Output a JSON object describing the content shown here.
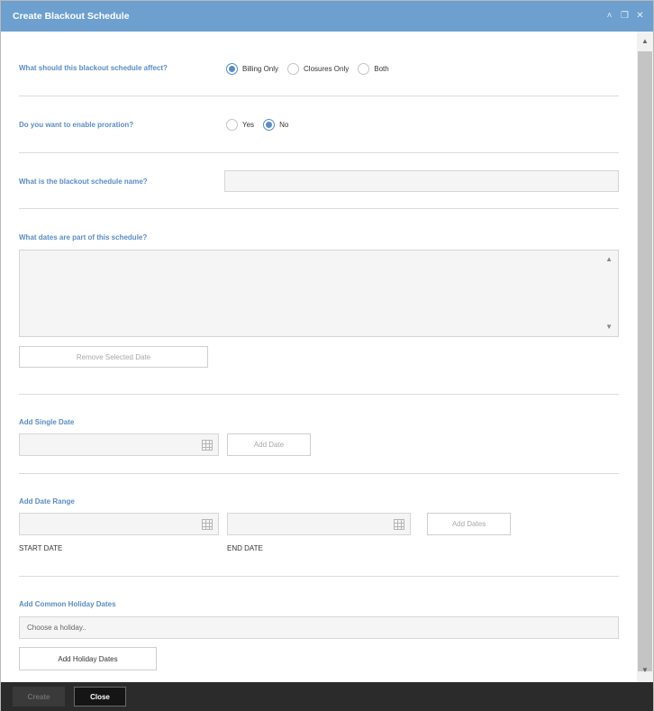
{
  "window": {
    "title": "Create Blackout Schedule"
  },
  "affect": {
    "question": "What should this blackout schedule affect?",
    "options": [
      {
        "label": "Billing Only",
        "selected": true
      },
      {
        "label": "Closures Only",
        "selected": false
      },
      {
        "label": "Both",
        "selected": false
      }
    ]
  },
  "proration": {
    "question": "Do you want to enable proration?",
    "options": [
      {
        "label": "Yes",
        "selected": false
      },
      {
        "label": "No",
        "selected": true
      }
    ]
  },
  "name": {
    "question": "What is the blackout schedule name?",
    "value": ""
  },
  "dates": {
    "question": "What dates are part of this schedule?",
    "remove_button": "Remove Selected Date"
  },
  "single_date": {
    "label": "Add Single Date",
    "value": "",
    "button": "Add Date"
  },
  "date_range": {
    "label": "Add Date Range",
    "start_value": "",
    "end_value": "",
    "button": "Add Dates",
    "start_caption": "START DATE",
    "end_caption": "END DATE"
  },
  "holidays": {
    "label": "Add Common Holiday Dates",
    "placeholder": "Choose a holiday..",
    "button": "Add Holiday Dates"
  },
  "footer": {
    "create_label": "Create",
    "close_label": "Close"
  }
}
